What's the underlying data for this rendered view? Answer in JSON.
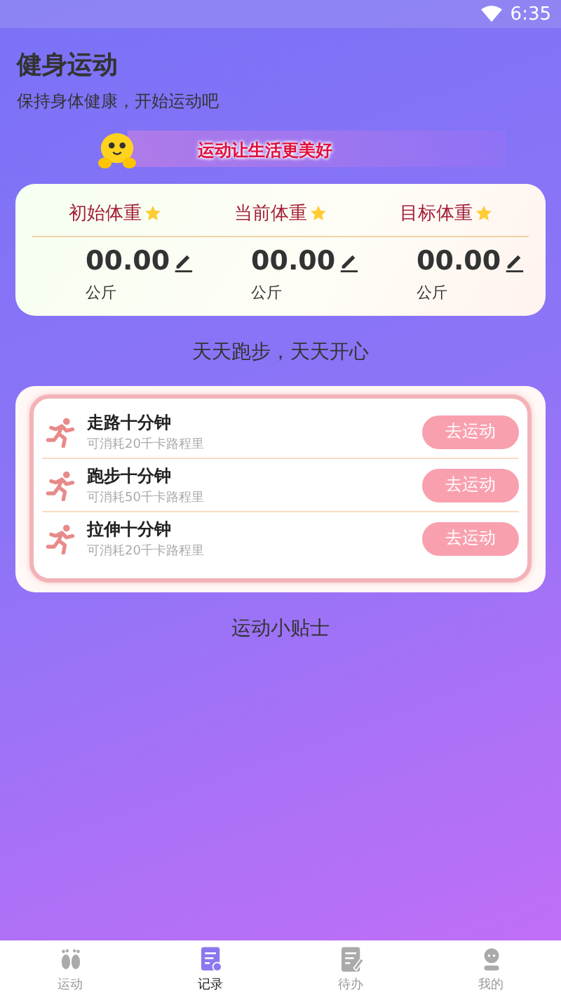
{
  "status_bar": {
    "time": "6:35"
  },
  "header": {
    "title": "健身运动",
    "subtitle": "保持身体健康，开始运动吧"
  },
  "banner": {
    "text": "运动让生活更美好"
  },
  "weights": [
    {
      "label": "初始体重",
      "value": "00.00",
      "unit": "公斤"
    },
    {
      "label": "当前体重",
      "value": "00.00",
      "unit": "公斤"
    },
    {
      "label": "目标体重",
      "value": "00.00",
      "unit": "公斤"
    }
  ],
  "slogan": "天天跑步，天天开心",
  "exercises": [
    {
      "title": "走路十分钟",
      "detail": "可消耗20千卡路程里",
      "button": "去运动"
    },
    {
      "title": "跑步十分钟",
      "detail": "可消耗50千卡路程里",
      "button": "去运动"
    },
    {
      "title": "拉伸十分钟",
      "detail": "可消耗20千卡路程里",
      "button": "去运动"
    }
  ],
  "tips_title": "运动小贴士",
  "tabs": [
    {
      "label": "运动",
      "kind": "feet",
      "selected": false
    },
    {
      "label": "记录",
      "kind": "record",
      "selected": true
    },
    {
      "label": "待办",
      "kind": "todo",
      "selected": false
    },
    {
      "label": "我的",
      "kind": "user",
      "selected": false
    }
  ]
}
